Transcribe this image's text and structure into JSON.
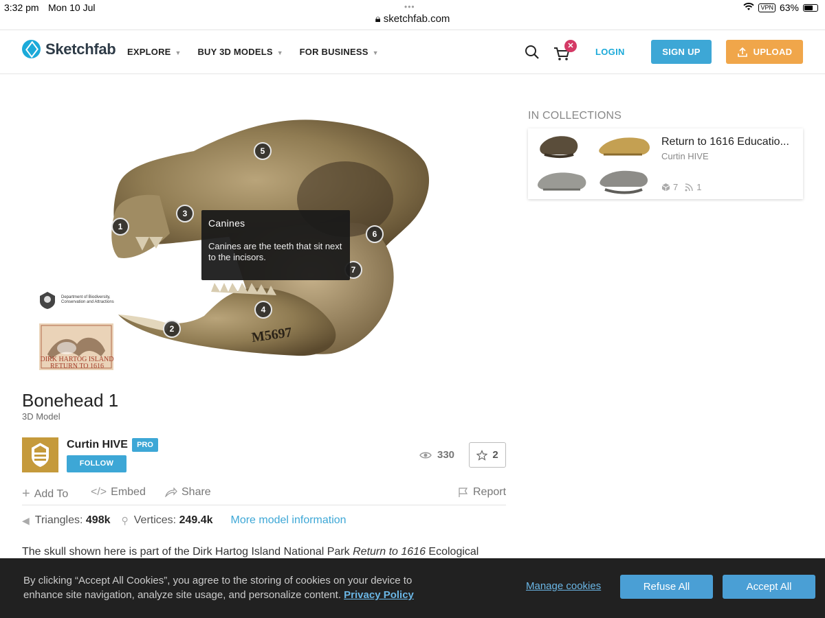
{
  "status_bar": {
    "time": "3:32 pm",
    "date": "Mon 10 Jul",
    "url": "sketchfab.com",
    "vpn": "VPN",
    "battery": "63%"
  },
  "nav": {
    "logo": "Sketchfab",
    "menu": [
      "EXPLORE",
      "BUY 3D MODELS",
      "FOR BUSINESS"
    ],
    "cart_badge": "✕",
    "login": "LOGIN",
    "signup": "SIGN UP",
    "upload": "UPLOAD"
  },
  "viewer": {
    "hotspots": [
      "1",
      "2",
      "3",
      "4",
      "5",
      "6",
      "7"
    ],
    "tooltip": {
      "title": "Canines",
      "body": "Canines are the teeth that sit next to the incisors."
    },
    "watermark_dept": "Department of Biodiversity, Conservation and Attractions",
    "watermark_project": "DIRK HARTOG ISLAND RETURN TO 1616"
  },
  "model": {
    "title": "Bonehead 1",
    "type": "3D Model",
    "author": "Curtin HIVE",
    "badge": "PRO",
    "follow": "FOLLOW",
    "views": "330",
    "likes": "2"
  },
  "actions": {
    "add_to": "Add To",
    "embed": "Embed",
    "share": "Share",
    "report": "Report"
  },
  "stats": {
    "triangles_label": "Triangles:",
    "triangles": "498k",
    "vertices_label": "Vertices:",
    "vertices": "249.4k",
    "more": "More model information"
  },
  "description": {
    "prefix": "The skull shown here is part of the Dirk Hartog Island National Park ",
    "italic": "Return to 1616",
    "suffix": " Ecological"
  },
  "collections": {
    "heading": "IN COLLECTIONS",
    "name": "Return to 1616 Educatio...",
    "author": "Curtin HIVE",
    "models": "7",
    "followers": "1"
  },
  "cookie": {
    "text": "By clicking “Accept All Cookies”, you agree to the storing of cookies on your device to enhance site navigation, analyze site usage, and personalize content.",
    "policy": "Privacy Policy",
    "manage": "Manage cookies",
    "refuse": "Refuse All",
    "accept": "Accept All"
  },
  "colors": {
    "brand_blue": "#1caad9",
    "button_blue": "#3da7d6",
    "upload_orange": "#f0a64a",
    "cookie_bg": "#212121"
  }
}
